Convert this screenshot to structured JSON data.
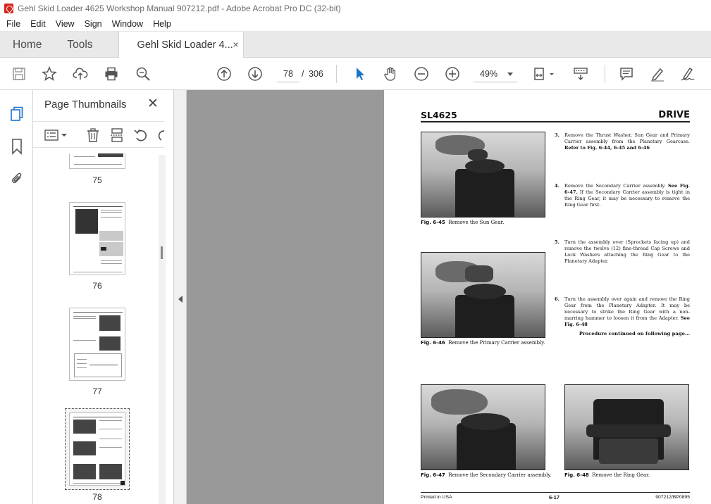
{
  "window": {
    "title": "Gehl Skid Loader 4625 Workshop Manual 907212.pdf - Adobe Acrobat Pro DC (32-bit)"
  },
  "menu": [
    "File",
    "Edit",
    "View",
    "Sign",
    "Window",
    "Help"
  ],
  "tabs": {
    "home": "Home",
    "tools": "Tools",
    "document": "Gehl Skid Loader 4...",
    "close": "×"
  },
  "toolbar": {
    "current_page": "78",
    "slash": "/",
    "total_pages": "306",
    "zoom": "49%"
  },
  "thumbnails": {
    "title": "Page Thumbnails",
    "close": "✕",
    "pages": [
      "75",
      "76",
      "77",
      "78"
    ],
    "selected": "78"
  },
  "pdf": {
    "header_left": "SL4625",
    "header_right": "DRIVE",
    "figures": [
      {
        "num": "Fig. 6-45",
        "caption": "Remove the Sun Gear."
      },
      {
        "num": "Fig. 6-46",
        "caption": "Remove the Primary Carrier assembly."
      },
      {
        "num": "Fig. 6-47",
        "caption": "Remove the Secondary Carrier assembly."
      },
      {
        "num": "Fig. 6-48",
        "caption": "Remove the Ring Gear."
      }
    ],
    "steps": [
      {
        "num": "3.",
        "text": "Remove the Thrust Washer, Sun Gear and Primary Carrier assembly from the Planetary Gearcase.",
        "ref": "Refer to Fig. 6-44, 6-45 and 6-46"
      },
      {
        "num": "4.",
        "text": "Remove the Secondary Carrier assembly.",
        "ref": "See Fig. 6-47.",
        "text2": "If the Secondary Carrier assembly is tight in the Ring Gear, it may be necessary to remove the Ring Gear first."
      },
      {
        "num": "5.",
        "text": "Turn the assembly over (Sprockets facing up) and remove the twelve (12) fine-thread Cap Screws and Lock Washers attaching the Ring Gear to the Planetary Adapter."
      },
      {
        "num": "6.",
        "text": "Turn the assembly over again and remove the Ring Gear from the Planetary Adapter. It may be necessary to strike the Ring Gear with a non-marring hammer to loosen it from the Adapter.",
        "ref": "See Fig. 6-48"
      }
    ],
    "continued": "Procedure continued on following page...",
    "footer_left": "Printed in USA",
    "footer_mid": "6-17",
    "footer_right": "907212/BP0895"
  }
}
